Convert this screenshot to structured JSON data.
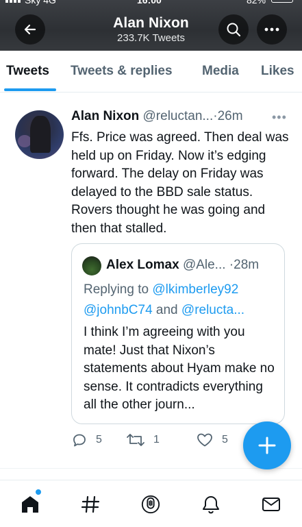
{
  "status_bar": {
    "carrier": "Sky 4G",
    "time": "16:00",
    "battery": "82%"
  },
  "header": {
    "title": "Alan Nixon",
    "subtitle": "233.7K Tweets"
  },
  "tabs": [
    {
      "label": "Tweets",
      "active": true
    },
    {
      "label": "Tweets & replies",
      "active": false
    },
    {
      "label": "Media",
      "active": false
    },
    {
      "label": "Likes",
      "active": false
    }
  ],
  "tweet": {
    "author_name": "Alan Nixon",
    "handle": "@reluctan...",
    "time": "26m",
    "text": "Ffs. Price was agreed. Then deal was held up on Friday. Now it’s edging forward. The delay on Friday was delayed to the BBD sale status. Rovers thought he was going and then that stalled.",
    "quoted": {
      "author_name": "Alex Lomax",
      "handle": "@Ale...",
      "time": "28m",
      "replying_prefix": "Replying to",
      "mention_1": "@lkimberley92",
      "mention_2": "@johnbC74",
      "conjunction": "and",
      "mention_3": "@relucta...",
      "text": "I think I’m agreeing with you mate! Just that Nixon’s statements about Hyam make no sense. It contradicts everything all the other journ..."
    },
    "actions": {
      "replies": "5",
      "retweets": "1",
      "likes": "5"
    }
  },
  "colors": {
    "accent": "#1d9bf0",
    "header_bg": "#2d3034",
    "text": "#0f1419",
    "muted": "#536471"
  },
  "bottom_nav": [
    "home-icon",
    "explore-hashtag-icon",
    "spaces-icon",
    "notifications-bell-icon",
    "messages-envelope-icon"
  ]
}
